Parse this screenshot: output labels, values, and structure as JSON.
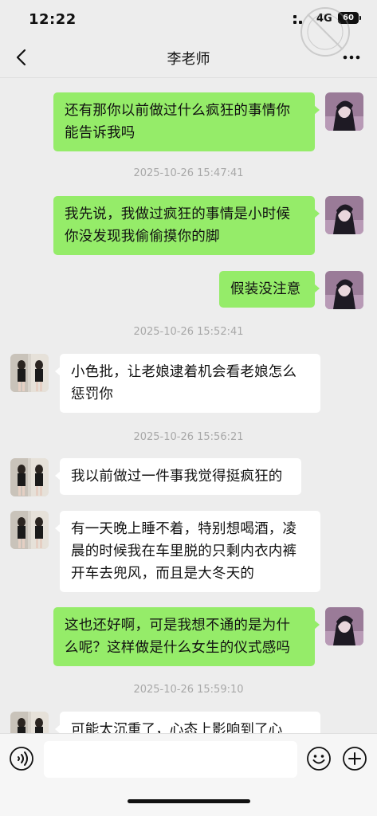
{
  "status_bar": {
    "time": "12:22",
    "network": "4G",
    "battery": "60"
  },
  "header": {
    "title": "李老师",
    "back_icon": "chevron-left-icon",
    "more_icon": "more-dots-icon"
  },
  "messages": [
    {
      "type": "message",
      "sender": "me",
      "text": "还有那你以前做过什么疯狂的事情你能告诉我吗"
    },
    {
      "type": "timestamp",
      "text": "2025-10-26 15:47:41"
    },
    {
      "type": "message",
      "sender": "me",
      "text": "我先说，我做过疯狂的事情是小时候你没发现我偷偷摸你的脚"
    },
    {
      "type": "message",
      "sender": "me",
      "text": "假装没注意"
    },
    {
      "type": "timestamp",
      "text": "2025-10-26 15:52:41"
    },
    {
      "type": "message",
      "sender": "them",
      "text": "小色批，让老娘逮着机会看老娘怎么惩罚你"
    },
    {
      "type": "timestamp",
      "text": "2025-10-26 15:56:21"
    },
    {
      "type": "message",
      "sender": "them",
      "text": "我以前做过一件事我觉得挺疯狂的"
    },
    {
      "type": "message",
      "sender": "them",
      "text": "有一天晚上睡不着，特别想喝酒，凌晨的时候我在车里脱的只剩内衣内裤开车去兜风，而且是大冬天的"
    },
    {
      "type": "message",
      "sender": "me",
      "text": "这也还好啊，可是我想不通的是为什么呢？这样做是什么女生的仪式感吗"
    },
    {
      "type": "timestamp",
      "text": "2025-10-26 15:59:10"
    },
    {
      "type": "message",
      "sender": "them",
      "text": "可能太沉重了，心态上影响到了心"
    }
  ],
  "input_bar": {
    "voice_icon": "voice-icon",
    "emoji_icon": "emoji-icon",
    "plus_icon": "plus-icon",
    "input_value": ""
  },
  "colors": {
    "background": "#ededed",
    "my_bubble": "#95ec69",
    "their_bubble": "#ffffff",
    "timestamp_text": "#a8a8a8"
  }
}
